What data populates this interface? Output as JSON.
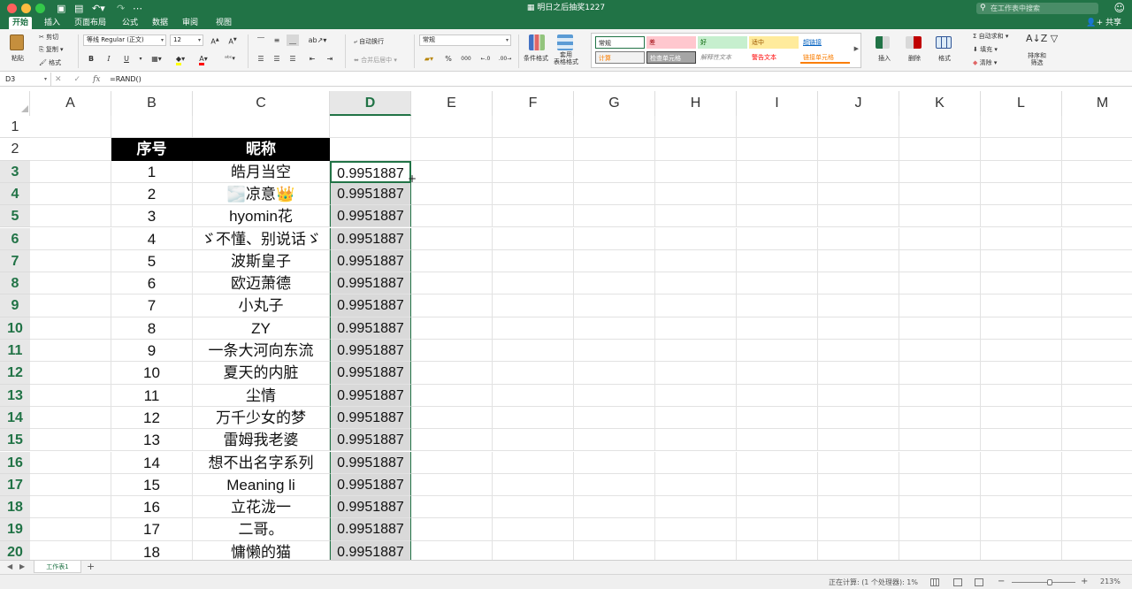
{
  "titlebar": {
    "doc_title": "明日之后抽奖1227",
    "search_placeholder": "在工作表中搜索",
    "share": "共享"
  },
  "ribbon_tabs": [
    "开始",
    "插入",
    "页面布局",
    "公式",
    "数据",
    "审阅",
    "视图"
  ],
  "ribbon": {
    "paste": "粘贴",
    "cut": "剪切",
    "copy": "复制",
    "format_painter": "格式",
    "font_name": "等线 Regular (正文)",
    "font_size": "12",
    "wrap_text": "自动换行",
    "merge_center": "合并后居中",
    "number_format": "常规",
    "percent": "%",
    "comma": "000",
    "cond_format": "条件格式",
    "table_format": "套用\n表格格式",
    "styles": [
      {
        "label": "常规",
        "bg": "#ffffff",
        "fg": "#222222"
      },
      {
        "label": "差",
        "bg": "#ffc7ce",
        "fg": "#9c0006"
      },
      {
        "label": "好",
        "bg": "#c6efce",
        "fg": "#006100"
      },
      {
        "label": "适中",
        "bg": "#ffeb9c",
        "fg": "#9c5700"
      },
      {
        "label": "超链接",
        "bg": "#ffffff",
        "fg": "#0563c1"
      },
      {
        "label": "计算",
        "bg": "#f2f2f2",
        "fg": "#fa7d00"
      },
      {
        "label": "检查单元格",
        "bg": "#a5a5a5",
        "fg": "#ffffff"
      },
      {
        "label": "解释性文本",
        "bg": "#ffffff",
        "fg": "#7f7f7f"
      },
      {
        "label": "警告文本",
        "bg": "#ffffff",
        "fg": "#ff0000"
      },
      {
        "label": "链接单元格",
        "bg": "#ffffff",
        "fg": "#fa7d00"
      }
    ],
    "insert": "插入",
    "delete": "删除",
    "format": "格式",
    "autosum": "自动求和",
    "fill": "填充",
    "clear": "清除",
    "sort_filter": "排序和\n筛选"
  },
  "formula_bar": {
    "name_box": "D3",
    "formula": "=RAND()"
  },
  "grid": {
    "columns": [
      "A",
      "B",
      "C",
      "D",
      "E",
      "F",
      "G",
      "H",
      "I",
      "J",
      "K",
      "L",
      "M"
    ],
    "selected_column": "D",
    "rows": [
      "1",
      "2",
      "3",
      "4",
      "5",
      "6",
      "7",
      "8",
      "9",
      "10",
      "11",
      "12",
      "13",
      "14",
      "15",
      "16",
      "17",
      "18",
      "19",
      "20"
    ],
    "header_row": {
      "seq": "序号",
      "nickname": "昵称"
    },
    "data": [
      {
        "seq": "1",
        "name": "皓月当空",
        "rand": "0.9951887"
      },
      {
        "seq": "2",
        "name": "🌫️凉意👑",
        "rand": "0.9951887"
      },
      {
        "seq": "3",
        "name": "hyomin花",
        "rand": "0.9951887"
      },
      {
        "seq": "4",
        "name": "ゞ不懂、别说话ゞ",
        "rand": "0.9951887"
      },
      {
        "seq": "5",
        "name": "波斯皇子",
        "rand": "0.9951887"
      },
      {
        "seq": "6",
        "name": "欧迈萧德",
        "rand": "0.9951887"
      },
      {
        "seq": "7",
        "name": "小丸子",
        "rand": "0.9951887"
      },
      {
        "seq": "8",
        "name": "ZY",
        "rand": "0.9951887"
      },
      {
        "seq": "9",
        "name": "一条大河向东流",
        "rand": "0.9951887"
      },
      {
        "seq": "10",
        "name": "夏天的内脏",
        "rand": "0.9951887"
      },
      {
        "seq": "11",
        "name": "尘情",
        "rand": "0.9951887"
      },
      {
        "seq": "12",
        "name": "万千少女的梦",
        "rand": "0.9951887"
      },
      {
        "seq": "13",
        "name": "雷姆我老婆",
        "rand": "0.9951887"
      },
      {
        "seq": "14",
        "name": "想不出名字系列",
        "rand": "0.9951887"
      },
      {
        "seq": "15",
        "name": "Meaning li",
        "rand": "0.9951887"
      },
      {
        "seq": "16",
        "name": "立花泷一",
        "rand": "0.9951887"
      },
      {
        "seq": "17",
        "name": "二哥。",
        "rand": "0.9951887"
      },
      {
        "seq": "18",
        "name": "慵懒的猫",
        "rand": "0.9951887"
      }
    ]
  },
  "sheet_tab": "工作表1",
  "status": {
    "text": "正在计算: (1 个处理器): 1%",
    "zoom": "213%"
  }
}
